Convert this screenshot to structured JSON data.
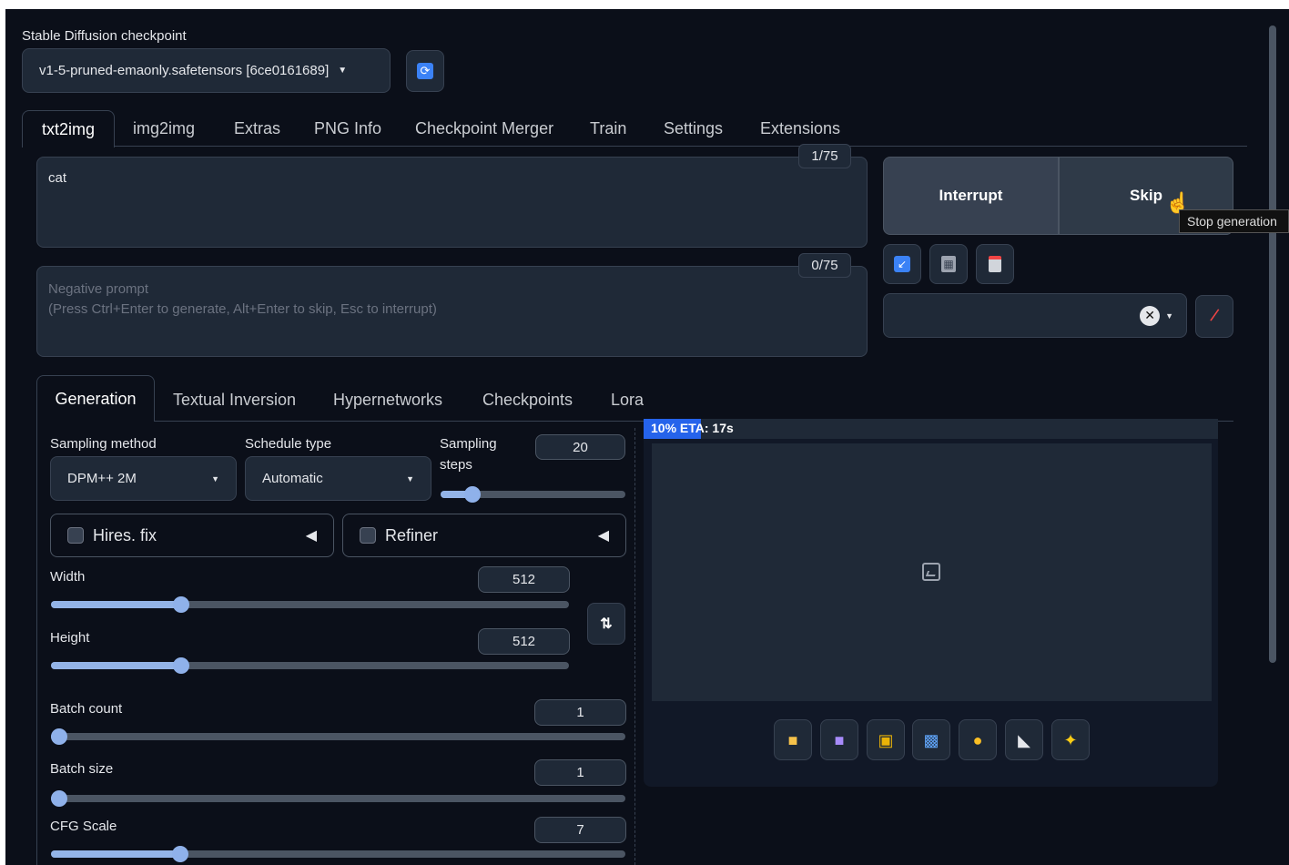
{
  "checkpoint": {
    "label": "Stable Diffusion checkpoint",
    "value": "v1-5-pruned-emaonly.safetensors [6ce0161689]",
    "refresh_icon": "refresh-icon"
  },
  "tabs": [
    "txt2img",
    "img2img",
    "Extras",
    "PNG Info",
    "Checkpoint Merger",
    "Train",
    "Settings",
    "Extensions"
  ],
  "prompt": {
    "value": "cat",
    "counter": "1/75"
  },
  "negative_prompt": {
    "placeholder_line1": "Negative prompt",
    "placeholder_line2": "(Press Ctrl+Enter to generate, Alt+Enter to skip, Esc to interrupt)",
    "counter": "0/75"
  },
  "actions": {
    "interrupt": "Interrupt",
    "skip": "Skip",
    "tooltip": "Stop generation"
  },
  "tool_icons": [
    "arrow-icon",
    "trash-icon",
    "clipboard-icon"
  ],
  "styles": {
    "value": "",
    "clear_icon": "close-icon"
  },
  "subtabs": [
    "Generation",
    "Textual Inversion",
    "Hypernetworks",
    "Checkpoints",
    "Lora"
  ],
  "generation": {
    "sampling_method": {
      "label": "Sampling method",
      "value": "DPM++ 2M"
    },
    "schedule_type": {
      "label": "Schedule type",
      "value": "Automatic"
    },
    "sampling_steps": {
      "label_line1": "Sampling",
      "label_line2": "steps",
      "value": "20",
      "fraction": 0.13
    },
    "hires_fix": {
      "label": "Hires. fix"
    },
    "refiner": {
      "label": "Refiner"
    },
    "width": {
      "label": "Width",
      "value": "512",
      "fraction": 0.236
    },
    "height": {
      "label": "Height",
      "value": "512",
      "fraction": 0.236
    },
    "batch_count": {
      "label": "Batch count",
      "value": "1",
      "fraction": 0.0
    },
    "batch_size": {
      "label": "Batch size",
      "value": "1",
      "fraction": 0.0
    },
    "cfg_scale": {
      "label": "CFG Scale",
      "value": "7",
      "fraction": 0.21
    }
  },
  "output": {
    "progress_text": "10% ETA: 17s",
    "progress_fraction": 0.1,
    "image_icon": "image-placeholder-icon",
    "toolbar_icons": [
      "folder-icon",
      "save-icon",
      "zip-icon",
      "send-to-img2img-icon",
      "send-to-inpaint-icon",
      "send-to-extras-icon",
      "upscale-icon"
    ]
  },
  "colors": {
    "background": "#0b0f19",
    "accent": "#8fb1ea",
    "progress": "#2563eb"
  }
}
